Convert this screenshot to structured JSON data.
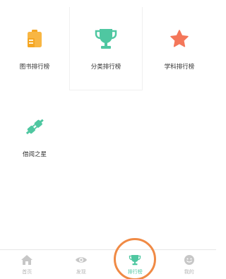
{
  "tiles": [
    {
      "label": "图书排行榜",
      "icon": "clipboard-icon",
      "color": "#f5a623"
    },
    {
      "label": "分类排行榜",
      "icon": "trophy-icon",
      "color": "#4fc7a1"
    },
    {
      "label": "学科排行榜",
      "icon": "star-icon",
      "color": "#f4775a"
    },
    {
      "label": "借阅之星",
      "icon": "plug-icon",
      "color": "#4fc7a1"
    }
  ],
  "tabbar": {
    "items": [
      {
        "label": "首页",
        "icon": "home-icon"
      },
      {
        "label": "发现",
        "icon": "eye-icon"
      },
      {
        "label": "排行榜",
        "icon": "trophy-icon",
        "active": true
      },
      {
        "label": "我的",
        "icon": "smile-face-icon"
      }
    ],
    "active_color": "#4fc7a1",
    "inactive_color": "#b5b5b5"
  },
  "highlight_color": "#f08a45"
}
